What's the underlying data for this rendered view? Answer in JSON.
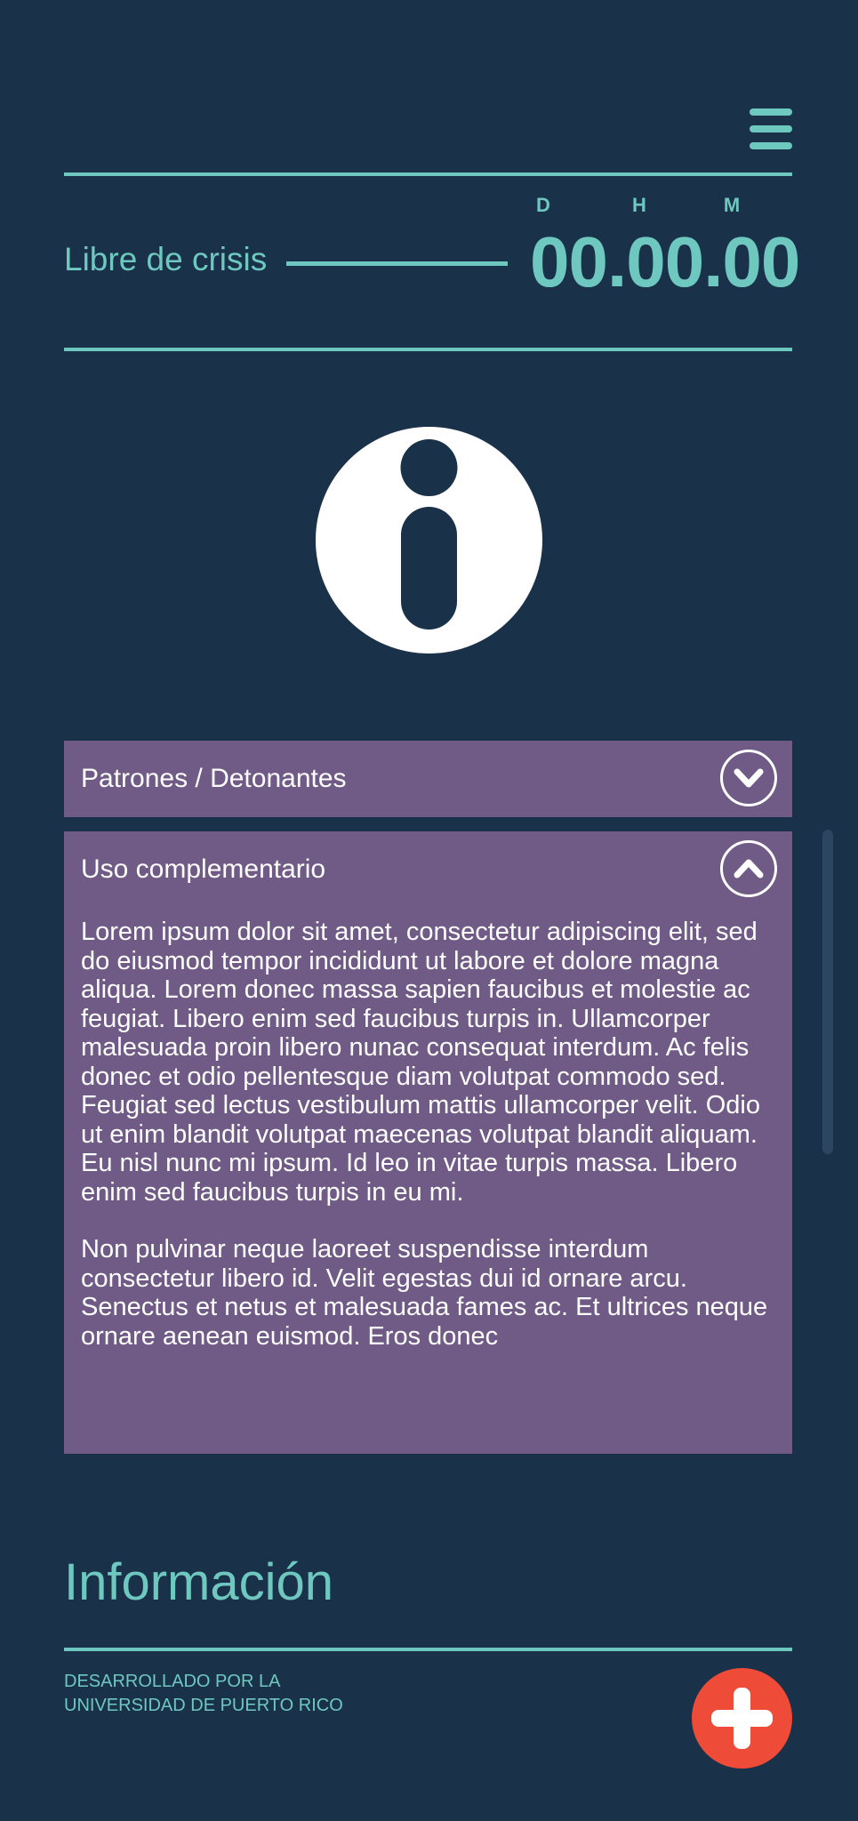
{
  "header": {
    "menu_icon": "hamburger-menu-icon"
  },
  "counter": {
    "label": "Libre de crisis",
    "units": {
      "days": "D",
      "hours": "H",
      "minutes": "M"
    },
    "value": "00.00.00"
  },
  "info_icon": "info-icon",
  "accordion": {
    "sections": [
      {
        "title": "Patrones / Detonantes",
        "state": "collapsed",
        "toggle_icon": "chevron-down-icon"
      },
      {
        "title": "Uso complementario",
        "state": "expanded",
        "toggle_icon": "chevron-up-icon",
        "paragraphs": [
          "Lorem ipsum dolor sit amet, consectetur adipiscing elit, sed do eiusmod tempor incididunt ut labore et dolore magna aliqua. Lorem donec massa sapien faucibus et molestie ac feugiat. Libero enim sed faucibus turpis in. Ullamcorper malesuada proin libero nunac consequat interdum. Ac felis donec et odio pellentesque diam volutpat commodo sed. Feugiat sed lectus vestibulum mattis ullamcorper velit. Odio ut enim blandit volutpat maecenas volutpat blandit aliquam. Eu nisl nunc mi ipsum. Id leo in vitae turpis massa. Libero enim sed faucibus turpis in eu mi.",
          "Non pulvinar neque laoreet suspendisse interdum consectetur libero id. Velit egestas dui id ornare arcu. Senectus et netus et malesuada fames ac. Et ultrices neque ornare aenean euismod. Eros donec"
        ]
      }
    ]
  },
  "footer": {
    "heading": "Información",
    "credits_line1": "DESARROLLADO POR LA",
    "credits_line2": "UNIVERSIDAD DE PUERTO RICO",
    "fab_icon": "plus-icon"
  },
  "colors": {
    "background": "#1a3249",
    "accent": "#6ec8c0",
    "panel": "#705a86",
    "fab": "#ee4b38"
  }
}
